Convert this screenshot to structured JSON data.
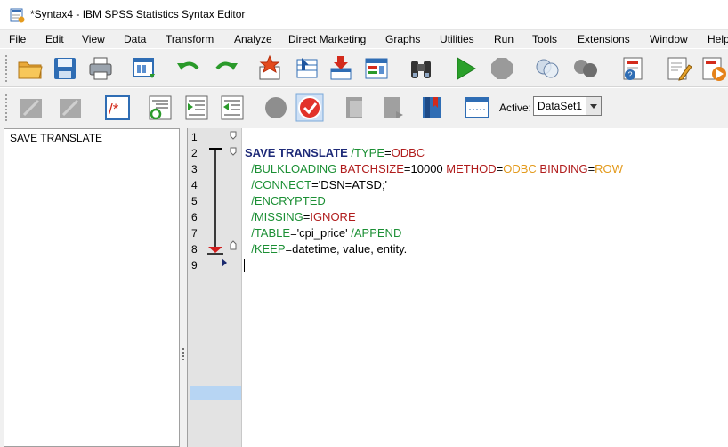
{
  "window": {
    "title": "*Syntax4 - IBM SPSS Statistics Syntax Editor"
  },
  "menu": [
    "File",
    "Edit",
    "View",
    "Data",
    "Transform",
    "Analyze",
    "Direct Marketing",
    "Graphs",
    "Utilities",
    "Run",
    "Tools",
    "Extensions",
    "Window",
    "Help"
  ],
  "toolbar1_icons": [
    "open-folder-icon",
    "save-icon",
    "print-icon",
    "recall-dialog-icon",
    "undo-icon",
    "redo-icon",
    "go-to-case-icon",
    "go-to-variable-icon",
    "insert-variable-icon",
    "variables-icon",
    "find-binoculars-icon",
    "run-selection-icon",
    "stop-icon",
    "merge-circles-icon",
    "split-circles-icon",
    "syntax-help-icon",
    "syntax-edit-icon",
    "syntax-play-icon"
  ],
  "toolbar2_icons": [
    "disabled-tool-icon",
    "disabled-tool-icon-2",
    "toggle-comment-icon",
    "auto-complete-icon",
    "indent-icon",
    "outdent-icon",
    "breakpoint-icon",
    "check-syntax-icon",
    "bookmark-disabled-icon",
    "bookmark-next-disabled-icon",
    "bookmark-icon",
    "command-span-icon"
  ],
  "active": {
    "label": "Active:",
    "dataset": "DataSet1"
  },
  "navigation": {
    "items": [
      "SAVE TRANSLATE"
    ]
  },
  "gutter": {
    "line_numbers": [
      "1",
      "2",
      "3",
      "4",
      "5",
      "6",
      "7",
      "8",
      "9"
    ]
  },
  "code": [
    [],
    [
      {
        "t": "SAVE TRANSLATE",
        "c": "cmd"
      },
      {
        "t": " /TYPE",
        "c": "sub"
      },
      {
        "t": "=",
        "c": "txt"
      },
      {
        "t": "ODBC",
        "c": "key"
      }
    ],
    [
      {
        "t": "  /BULKLOADING",
        "c": "sub"
      },
      {
        "t": " BATCHSIZE",
        "c": "key"
      },
      {
        "t": "=10000 ",
        "c": "txt"
      },
      {
        "t": "METHOD",
        "c": "key"
      },
      {
        "t": "=",
        "c": "txt"
      },
      {
        "t": "ODBC",
        "c": "val"
      },
      {
        "t": " BINDING",
        "c": "key"
      },
      {
        "t": "=",
        "c": "txt"
      },
      {
        "t": "ROW",
        "c": "val"
      }
    ],
    [
      {
        "t": "  /CONNECT",
        "c": "sub"
      },
      {
        "t": "='DSN=ATSD;'",
        "c": "txt"
      }
    ],
    [
      {
        "t": "  /ENCRYPTED",
        "c": "sub"
      }
    ],
    [
      {
        "t": "  /MISSING",
        "c": "sub"
      },
      {
        "t": "=",
        "c": "txt"
      },
      {
        "t": "IGNORE",
        "c": "key"
      }
    ],
    [
      {
        "t": "  /TABLE",
        "c": "sub"
      },
      {
        "t": "='cpi_price' ",
        "c": "txt"
      },
      {
        "t": "/APPEND",
        "c": "sub"
      }
    ],
    [
      {
        "t": "  /KEEP",
        "c": "sub"
      },
      {
        "t": "=datetime, value, entity.",
        "c": "txt"
      }
    ],
    []
  ]
}
